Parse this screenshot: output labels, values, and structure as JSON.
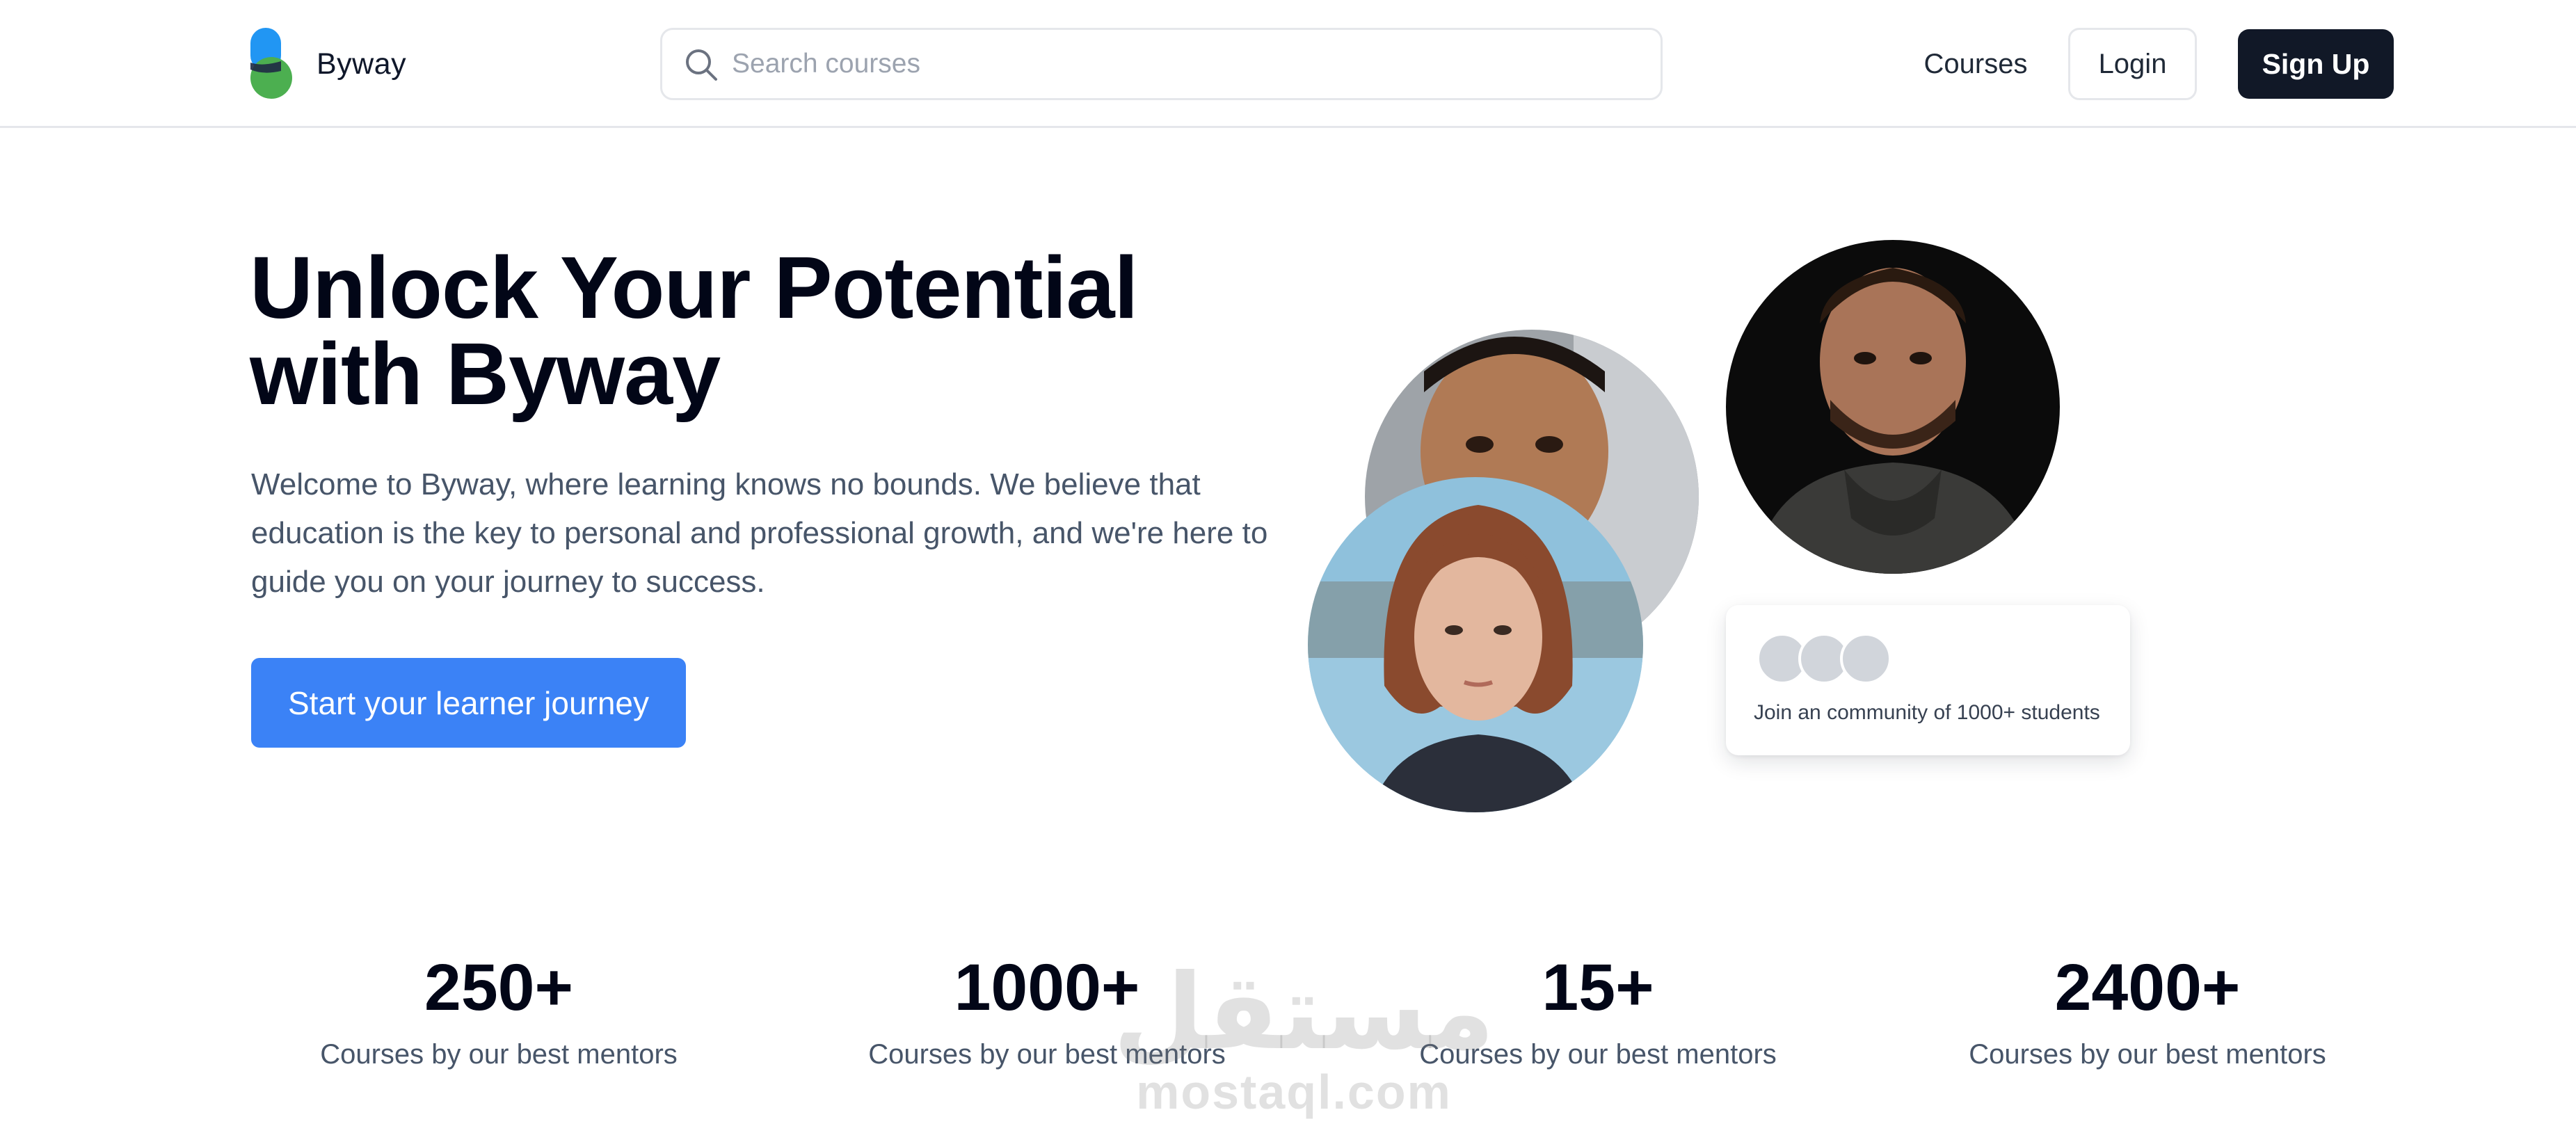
{
  "header": {
    "brand": "Byway",
    "search": {
      "placeholder": "Search courses",
      "value": ""
    },
    "nav_courses": "Courses",
    "login": "Login",
    "signup": "Sign Up"
  },
  "hero": {
    "title": "Unlock Your Potential with Byway",
    "description": "Welcome to Byway, where learning knows no bounds. We believe that education is the key to personal and professional growth, and we're here to guide you on your journey to success.",
    "cta": "Start your learner journey"
  },
  "community": {
    "text": "Join an community of 1000+ students"
  },
  "stats": [
    {
      "value": "250+",
      "label": "Courses by our best mentors"
    },
    {
      "value": "1000+",
      "label": "Courses by our best mentors"
    },
    {
      "value": "15+",
      "label": "Courses by our best mentors"
    },
    {
      "value": "2400+",
      "label": "Courses by our best mentors"
    }
  ],
  "watermark": {
    "arabic": "مستقل",
    "latin": "mostaql.com"
  },
  "colors": {
    "primary": "#3b82f6",
    "dark": "#111827",
    "logo_blue": "#2196f3",
    "logo_green": "#4caf50"
  },
  "icons": {
    "search": "search-icon",
    "logo": "byway-logo-icon"
  }
}
